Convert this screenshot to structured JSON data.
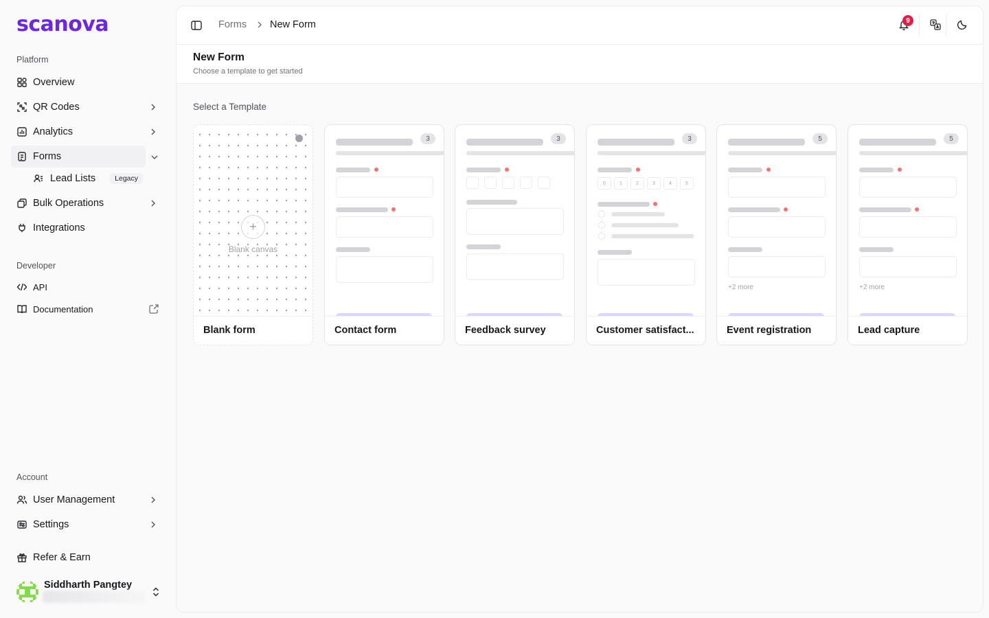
{
  "brand": {
    "logo_text": "scanova",
    "accent": "#6d28d9"
  },
  "sidebar": {
    "platform_label": "Platform",
    "items": [
      {
        "label": "Overview",
        "icon": "grid-icon"
      },
      {
        "label": "QR Codes",
        "icon": "qr-scan-icon"
      },
      {
        "label": "Analytics",
        "icon": "bar-chart-icon"
      },
      {
        "label": "Forms",
        "icon": "form-icon"
      },
      {
        "label": "Lead Lists",
        "icon": "user-list-icon",
        "badge": "Legacy"
      },
      {
        "label": "Bulk Operations",
        "icon": "stack-icon"
      },
      {
        "label": "Integrations",
        "icon": "plug-icon"
      }
    ],
    "developer_label": "Developer",
    "dev_items": [
      {
        "label": "API",
        "icon": "code-icon"
      },
      {
        "label": "Documentation",
        "icon": "book-icon"
      }
    ],
    "account_label": "Account",
    "account_items": [
      {
        "label": "User Management",
        "icon": "users-icon"
      },
      {
        "label": "Settings",
        "icon": "settings-icon"
      }
    ],
    "refer_label": "Refer & Earn",
    "user_name": "Siddharth Pangtey"
  },
  "topbar": {
    "breadcrumb_parent": "Forms",
    "breadcrumb_current": "New Form",
    "notification_count": "9"
  },
  "page": {
    "title": "New Form",
    "subtitle": "Choose a template to get started",
    "section_label": "Select a Template"
  },
  "templates": [
    {
      "name": "Blank form",
      "preview_text": "Blank canvas"
    },
    {
      "name": "Contact form",
      "count": "3"
    },
    {
      "name": "Feedback survey",
      "count": "3"
    },
    {
      "name": "Customer satisfact...",
      "count": "3",
      "scale": [
        "0",
        "1",
        "2",
        "3",
        "4",
        "5"
      ]
    },
    {
      "name": "Event registration",
      "count": "5",
      "more": "+2 more"
    },
    {
      "name": "Lead capture",
      "count": "5",
      "more": "+2 more"
    }
  ]
}
